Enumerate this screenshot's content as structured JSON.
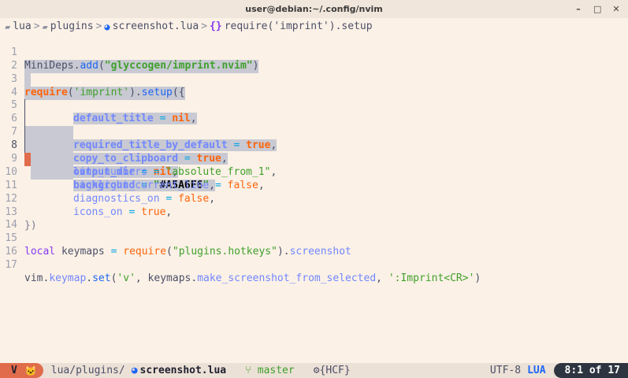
{
  "window": {
    "title": "user@debian:~/.config/nvim",
    "minimize_glyph": "–",
    "maximize_glyph": "□",
    "close_glyph": "✕"
  },
  "winbar": {
    "folder1": "lua",
    "folder2": "plugins",
    "file": "screenshot.lua",
    "symbol": "require('imprint').setup",
    "separator": ">",
    "folder_icon": "folder-icon",
    "lua_icon": "lua-icon",
    "symbol_icon": "braces-icon"
  },
  "lines": {
    "n1": "1",
    "n2": "2",
    "n3": "3",
    "n4": "4",
    "n5": "5",
    "n6": "6",
    "n7": "7",
    "n8": "8",
    "n9": "9",
    "n10": "10",
    "n11": "11",
    "n12": "12",
    "n13": "13",
    "n14": "14",
    "n15": "15",
    "n16": "16",
    "n17": "17"
  },
  "code": {
    "l1": {
      "a": "MiniDeps",
      "b": ".",
      "c": "add",
      "d": "(",
      "e": "\"glyccogen/imprint.nvim\"",
      "f": ")"
    },
    "l3": {
      "a": "require",
      "b": "(",
      "c": "'imprint'",
      "d": ").",
      "e": "setup",
      "f": "({"
    },
    "l4": {
      "k": "default_title",
      "eq": " = ",
      "v": "nil",
      "c": ","
    },
    "l5": {
      "k": "required_title_by_default",
      "eq": " = ",
      "v": "true",
      "c": ","
    },
    "l6": {
      "k": "copy_to_clipboard",
      "eq": " = ",
      "v": "true",
      "c": ","
    },
    "l7": {
      "k": "output_dir",
      "eq": " = ",
      "v": "nil",
      "c": ","
    },
    "l8": {
      "k": "background",
      "eq": " = ",
      "q1": "\"",
      "v": "#A5A6F6",
      "q2": "\"",
      "c": ","
    },
    "l9": {
      "k": "line_numbers",
      "eq": " = ",
      "v": "\"absolute_from_1\"",
      "c": ","
    },
    "l10": {
      "k": "highlight_current_line",
      "eq": " = ",
      "v": "false",
      "c": ","
    },
    "l11": {
      "k": "diagnostics_on",
      "eq": " = ",
      "v": "false",
      "c": ","
    },
    "l12": {
      "k": "icons_on",
      "eq": " = ",
      "v": "true",
      "c": ","
    },
    "l13": {
      "a": "})"
    },
    "l15": {
      "a": "local",
      "b": " keymaps ",
      "c": "=",
      "d": " ",
      "e": "require",
      "f": "(",
      "g": "\"plugins.hotkeys\"",
      "h": ").",
      "i": "screenshot"
    },
    "l17": {
      "a": "vim",
      "b": ".",
      "c": "keymap",
      "d": ".",
      "e": "set",
      "f": "(",
      "g": "'v'",
      "h": ", keymaps.",
      "i": "make_screenshot_from_selected",
      "j": ", ",
      "k": "':Imprint<CR>'",
      "l": ")"
    }
  },
  "statusline": {
    "mode": "V",
    "mode_icon": "cat-icon",
    "path": "lua/plugins/",
    "file": "screenshot.lua",
    "branch_icon": "git-branch-icon",
    "branch": "master",
    "gear_icon": "gear-icon",
    "lsp": "{HCF}",
    "encoding": "UTF-8",
    "filetype": "LUA",
    "position": "8:1 of 17"
  },
  "colors": {
    "accent": "#e06c4c",
    "selection": "#c8c9d2",
    "background": "#fbf1e6"
  }
}
